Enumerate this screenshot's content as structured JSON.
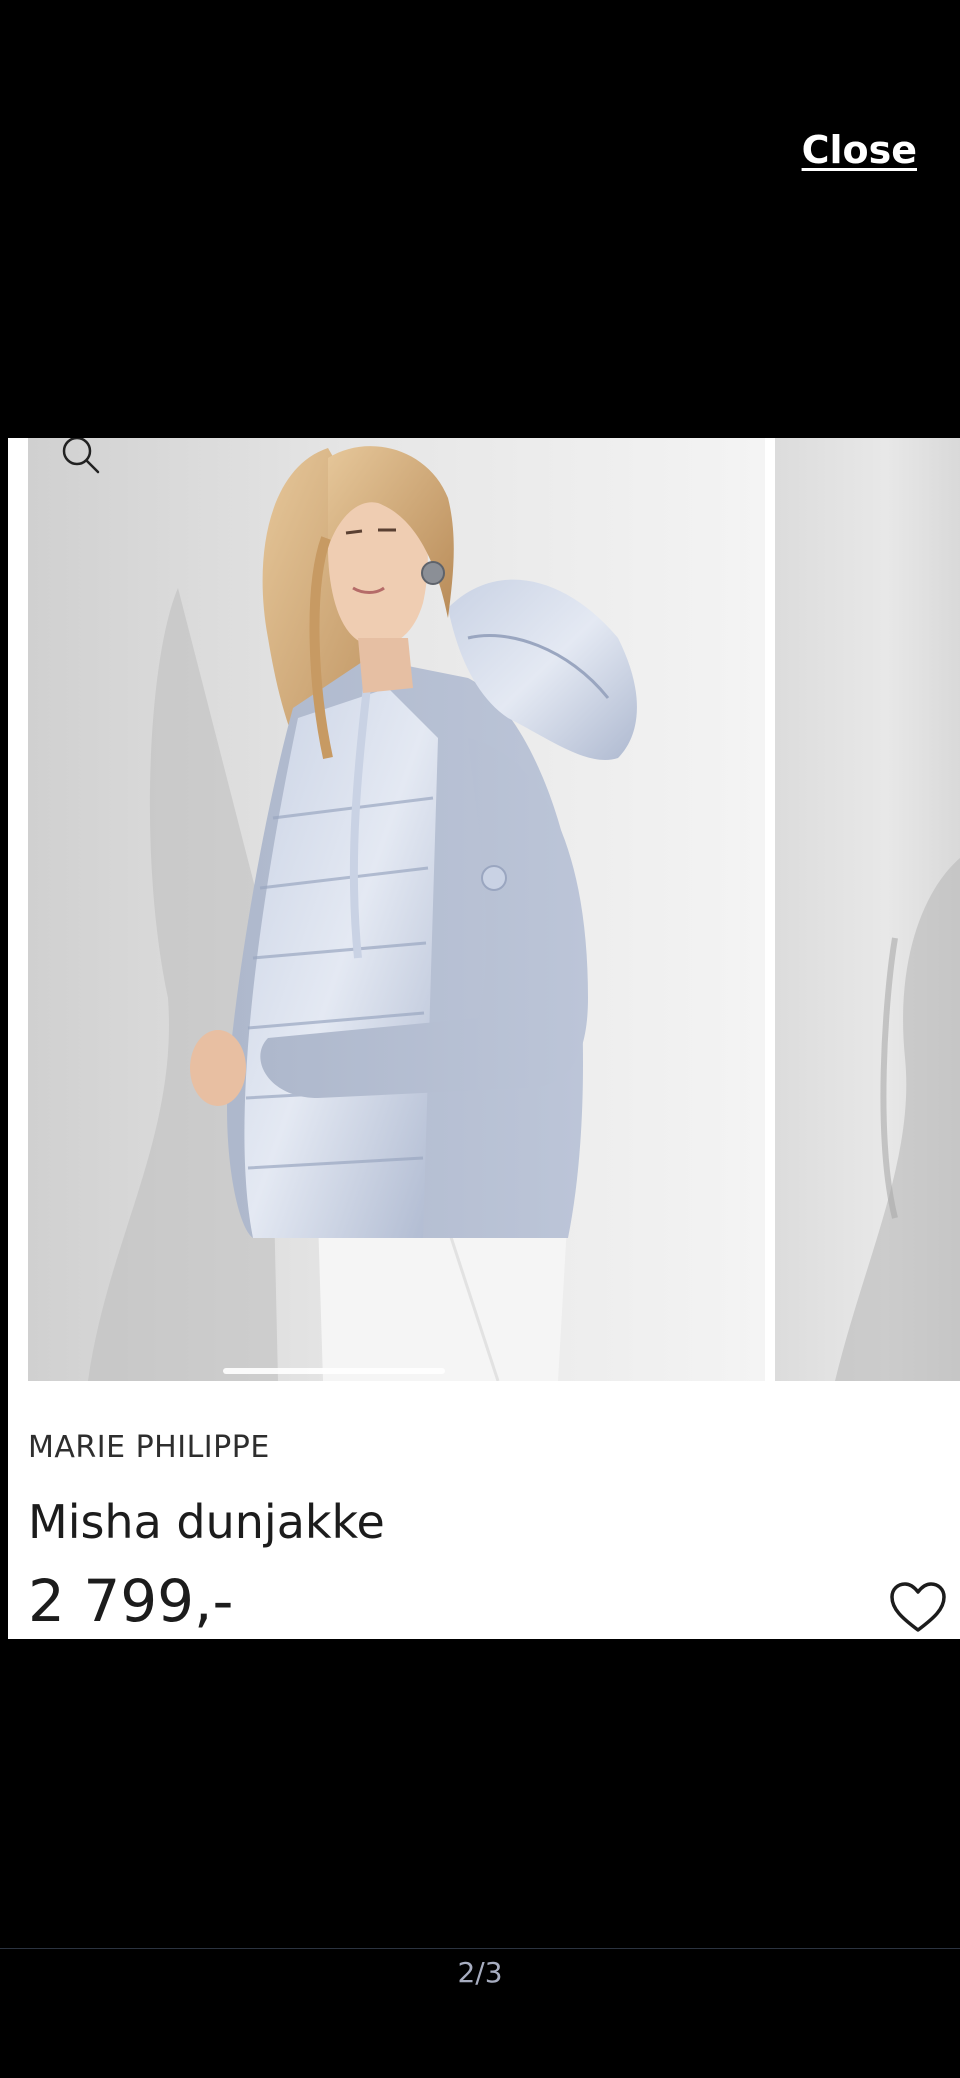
{
  "viewer": {
    "close_label": "Close",
    "page_counter": "2/3"
  },
  "product": {
    "brand": "MARIE PHILIPPE",
    "name": "Misha dunjakke",
    "price": "2 799,-"
  },
  "icons": {
    "zoom": "search-icon",
    "favorite": "heart-icon"
  },
  "colors": {
    "background": "#000000",
    "card": "#ffffff",
    "jacket": "#b7c1d6",
    "text": "#1c1c1c",
    "counter": "#a7adc0"
  }
}
